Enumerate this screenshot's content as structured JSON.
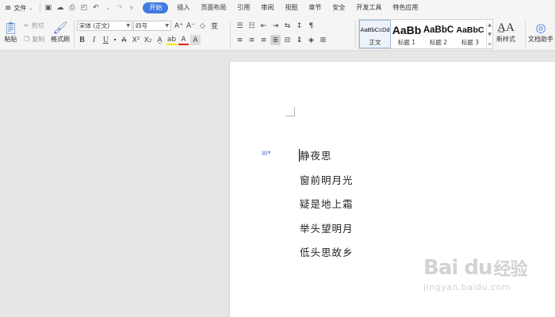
{
  "menubar": {
    "file_label": "文件",
    "tabs": [
      "开始",
      "插入",
      "页面布局",
      "引用",
      "审阅",
      "视图",
      "章节",
      "安全",
      "开发工具",
      "特色应用"
    ],
    "active_tab": "开始",
    "accent_color": "#3f7be0"
  },
  "ribbon": {
    "paste_label": "粘贴",
    "cut_label": "剪切",
    "copy_label": "复制",
    "format_painter_label": "格式刷",
    "font_name": "宋体 (正文)",
    "font_size": "四号",
    "styles": [
      {
        "preview": "AaBbCcDd",
        "label": "正文"
      },
      {
        "preview": "AaBb",
        "label": "标题 1"
      },
      {
        "preview": "AaBbC",
        "label": "标题 2"
      },
      {
        "preview": "AaBbC",
        "label": "标题 3"
      }
    ],
    "new_style_label": "新样式",
    "doc_assistant_label": "文档助手"
  },
  "document": {
    "lines": [
      "静夜思",
      "窗前明月光",
      "疑是地上霜",
      "举头望明月",
      "低头思故乡"
    ]
  },
  "watermark": {
    "brand": "Bai du",
    "cn": "经验",
    "url": "jingyan.baidu.com"
  }
}
